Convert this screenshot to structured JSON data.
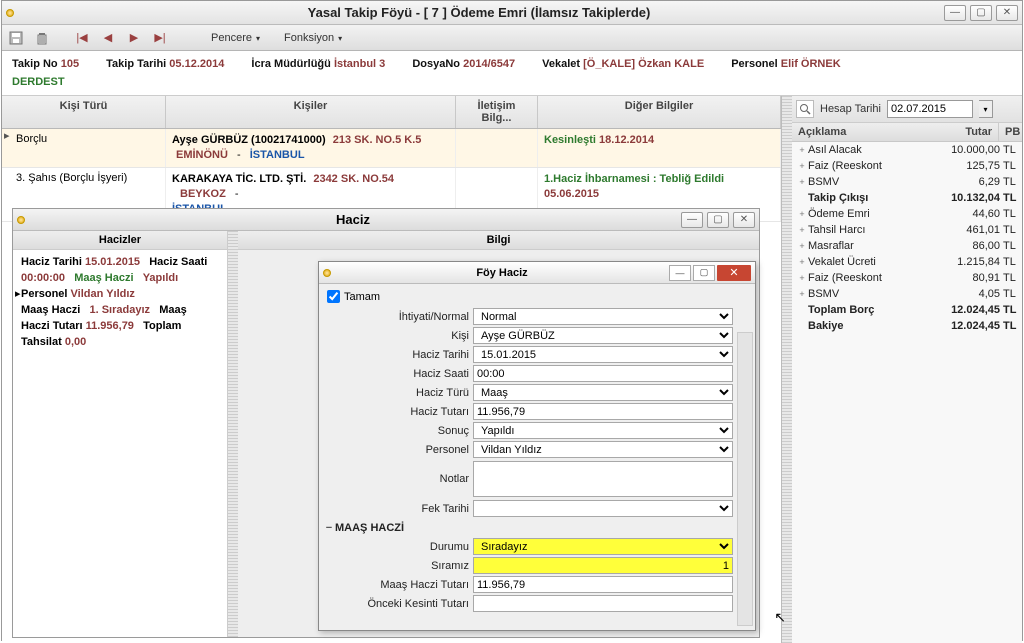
{
  "title": "Yasal Takip Föyü - [ 7 ] Ödeme Emri (İlamsız Takiplerde)",
  "menus": {
    "pencere": "Pencere",
    "fonksiyon": "Fonksiyon"
  },
  "info": {
    "takip_no_l": "Takip No",
    "takip_no": "105",
    "takip_tarihi_l": "Takip Tarihi",
    "takip_tarihi": "05.12.2014",
    "icra_l": "İcra Müdürlüğü",
    "icra": "İstanbul 3",
    "dosya_l": "DosyaNo",
    "dosya": "2014/6547",
    "vekalet_l": "Vekalet",
    "vekalet": "[Ö_KALE] Özkan KALE",
    "personel_l": "Personel",
    "personel": "Elif ÖRNEK",
    "durum": "DERDEST"
  },
  "gridhdr": {
    "tur": "Kişi Türü",
    "kisi": "Kişiler",
    "ile": "İletişim Bilg...",
    "diger": "Diğer Bilgiler"
  },
  "rows": [
    {
      "tur": "Borçlu",
      "kisi_name": "Ayşe GÜRBÜZ (10021741000)",
      "kisi_addr": "213 SK. NO.5 K.5",
      "kisi_district": "EMİNÖNÜ",
      "kisi_sep": "-",
      "kisi_city": "İSTANBUL",
      "ile": "",
      "d1": "Kesinleşti",
      "d1v": "18.12.2014",
      "d2": "",
      "d2v": ""
    },
    {
      "tur": "3. Şahıs (Borçlu İşyeri)",
      "kisi_name": "KARAKAYA TİC. LTD. ŞTİ.",
      "kisi_addr": "2342 SK. NO.54",
      "kisi_district": "BEYKOZ",
      "kisi_sep": "-",
      "kisi_city": "İSTANBUL",
      "ile": "",
      "d1": "1.Haciz İhbarnamesi : Tebliğ Edildi",
      "d1v": "05.06.2015",
      "d2": "",
      "d2v": ""
    }
  ],
  "sub": {
    "title": "Haciz",
    "hacizler": "Hacizler",
    "bilgi": "Bilgi",
    "body": {
      "l1a": "Haciz Tarihi",
      "l1b": "15.01.2015",
      "l1c": "Haciz Saati",
      "l2a": "00:00:00",
      "l2b": "Maaş Haczi",
      "l2c": "Yapıldı",
      "l3a": "Personel",
      "l3b": "Vildan Yıldız",
      "l4a": "Maaş Haczi",
      "l4b": "1. Sıradayız",
      "l4c": "Maaş",
      "l5a": "Haczi Tutarı",
      "l5b": "11.956,79",
      "l5c": "Toplam",
      "l6a": "Tahsilat",
      "l6b": "0,00"
    }
  },
  "dlg": {
    "title": "Föy Haciz",
    "tamam": "Tamam",
    "fields": {
      "ihtiyati": {
        "l": "İhtiyati/Normal",
        "v": "Normal"
      },
      "kisi": {
        "l": "Kişi",
        "v": "Ayşe GÜRBÜZ"
      },
      "tarih": {
        "l": "Haciz Tarihi",
        "v": "15.01.2015"
      },
      "saat": {
        "l": "Haciz Saati",
        "v": "00:00"
      },
      "turu": {
        "l": "Haciz Türü",
        "v": "Maaş"
      },
      "tutar": {
        "l": "Haciz Tutarı",
        "v": "11.956,79"
      },
      "sonuc": {
        "l": "Sonuç",
        "v": "Yapıldı"
      },
      "personel": {
        "l": "Personel",
        "v": "Vildan Yıldız"
      },
      "notlar": {
        "l": "Notlar",
        "v": ""
      },
      "fek": {
        "l": "Fek Tarihi",
        "v": ""
      },
      "section": "MAAŞ HACZİ",
      "durumu": {
        "l": "Durumu",
        "v": "Sıradayız"
      },
      "siramiz": {
        "l": "Sıramız",
        "v": "1"
      },
      "mht": {
        "l": "Maaş Haczi Tutarı",
        "v": "11.956,79"
      },
      "okt": {
        "l": "Önceki Kesinti Tutarı",
        "v": ""
      }
    }
  },
  "right": {
    "hesap_l": "Hesap Tarihi",
    "hesap_v": "02.07.2015",
    "h1": "Açıklama",
    "h2": "Tutar",
    "h3": "PB",
    "rows": [
      {
        "exp": "+",
        "n": "Asıl Alacak",
        "a": "10.000,00",
        "u": "TL"
      },
      {
        "exp": "+",
        "n": "Faiz (Reeskont",
        "a": "125,75",
        "u": "TL"
      },
      {
        "exp": "+",
        "n": "BSMV",
        "a": "6,29",
        "u": "TL"
      },
      {
        "exp": "",
        "n": "Takip Çıkışı",
        "a": "10.132,04",
        "u": "TL",
        "bold": true
      },
      {
        "exp": "+",
        "n": "Ödeme Emri",
        "a": "44,60",
        "u": "TL"
      },
      {
        "exp": "+",
        "n": "Tahsil Harcı",
        "a": "461,01",
        "u": "TL"
      },
      {
        "exp": "+",
        "n": "Masraflar",
        "a": "86,00",
        "u": "TL"
      },
      {
        "exp": "+",
        "n": "Vekalet Ücreti",
        "a": "1.215,84",
        "u": "TL"
      },
      {
        "exp": "+",
        "n": "Faiz (Reeskont",
        "a": "80,91",
        "u": "TL"
      },
      {
        "exp": "+",
        "n": "BSMV",
        "a": "4,05",
        "u": "TL"
      },
      {
        "exp": "",
        "n": "Toplam Borç",
        "a": "12.024,45",
        "u": "TL",
        "bold": true
      },
      {
        "exp": "",
        "n": "Bakiye",
        "a": "12.024,45",
        "u": "TL",
        "bold": true
      }
    ]
  }
}
